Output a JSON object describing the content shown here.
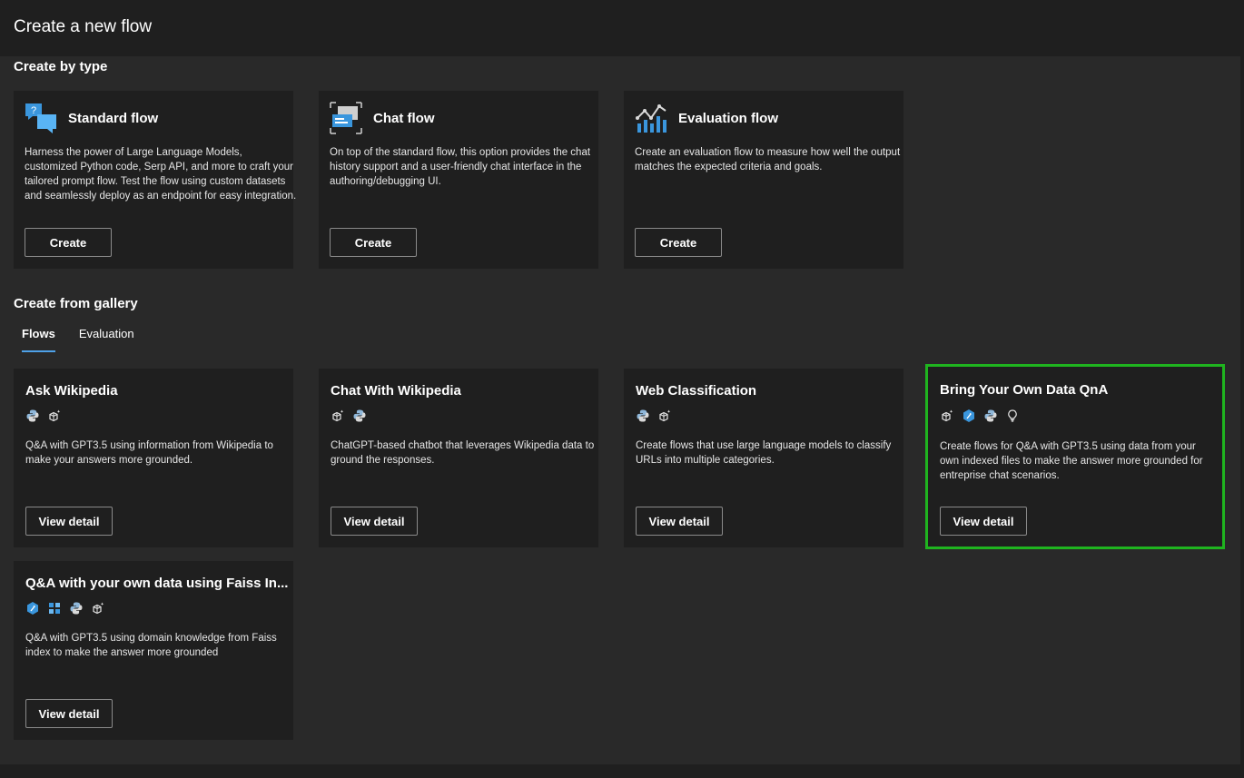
{
  "page": {
    "title": "Create a new flow"
  },
  "create_by_type": {
    "heading": "Create by type",
    "cards": [
      {
        "title": "Standard flow",
        "icon": "chat-question-icon",
        "description": "Harness the power of Large Language Models, customized Python code, Serp API, and more to craft your tailored prompt flow. Test the flow using custom datasets and seamlessly deploy as an endpoint for easy integration.",
        "button": "Create"
      },
      {
        "title": "Chat flow",
        "icon": "chat-window-icon",
        "description": "On top of the standard flow, this option provides the chat history support and a user-friendly chat interface in the authoring/debugging UI.",
        "button": "Create"
      },
      {
        "title": "Evaluation flow",
        "icon": "line-chart-icon",
        "description": "Create an evaluation flow to measure how well the output matches the expected criteria and goals.",
        "button": "Create"
      }
    ]
  },
  "gallery": {
    "heading": "Create from gallery",
    "tabs": [
      "Flows",
      "Evaluation"
    ],
    "active_tab": "Flows",
    "cards": [
      {
        "title": "Ask Wikipedia",
        "icons": [
          "python-icon",
          "llm-sparkle-icon"
        ],
        "description": "Q&A with GPT3.5 using information from Wikipedia to make your answers more grounded.",
        "button": "View detail"
      },
      {
        "title": "Chat With Wikipedia",
        "icons": [
          "llm-sparkle-icon",
          "python-icon"
        ],
        "description": "ChatGPT-based chatbot that leverages Wikipedia data to ground the responses.",
        "button": "View detail"
      },
      {
        "title": "Web Classification",
        "icons": [
          "python-icon",
          "llm-sparkle-icon"
        ],
        "description": "Create flows that use large language models to classify URLs into multiple categories.",
        "button": "View detail"
      },
      {
        "title": "Bring Your Own Data QnA",
        "icons": [
          "llm-sparkle-icon",
          "tool-icon",
          "python-icon",
          "lightbulb-icon"
        ],
        "description": "Create flows for Q&A with GPT3.5 using data from your own indexed files to make the answer more grounded for entreprise chat scenarios.",
        "button": "View detail",
        "highlighted": true
      },
      {
        "title": "Q&A with your own data using Faiss In...",
        "icons": [
          "tool-icon",
          "vector-grid-icon",
          "python-icon",
          "llm-sparkle-icon"
        ],
        "description": "Q&A with GPT3.5 using domain knowledge from Faiss index to make the answer more grounded",
        "button": "View detail"
      }
    ]
  },
  "colors": {
    "background": "#1f1f1f",
    "panel": "#292929",
    "card": "#1f1f1f",
    "highlight_border": "#1fb41f",
    "tab_underline": "#4ea1e8",
    "icon_blue": "#3a96dd"
  }
}
